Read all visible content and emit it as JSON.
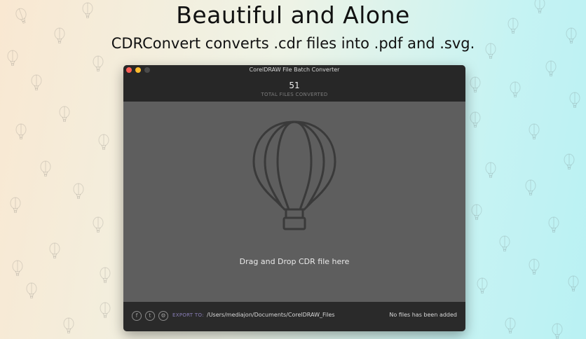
{
  "promo": {
    "headline": "Beautiful and Alone",
    "subline": "CDRConvert converts .cdr files into .pdf and .svg."
  },
  "window": {
    "title": "CorelDRAW File Batch Converter",
    "files_converted_count": "51",
    "files_converted_label": "TOTAL FILES CONVERTED",
    "drop_prompt": "Drag and Drop CDR file here",
    "balloon_icon": "hot-air-balloon-icon"
  },
  "footer": {
    "icons": [
      "facebook-icon",
      "twitter-icon",
      "gear-icon"
    ],
    "export_label": "EXPORT TO:",
    "export_path": "/Users/mediajon/Documents/CorelDRAW_Files",
    "status": "No files has been added"
  },
  "colors": {
    "window_bg": "#5e5e5e",
    "titlebar_bg": "#272727",
    "footer_bg": "#2a2a2a",
    "accent_export": "#8a7fb8",
    "close": "#ff5f57",
    "minimize": "#febc2e"
  }
}
